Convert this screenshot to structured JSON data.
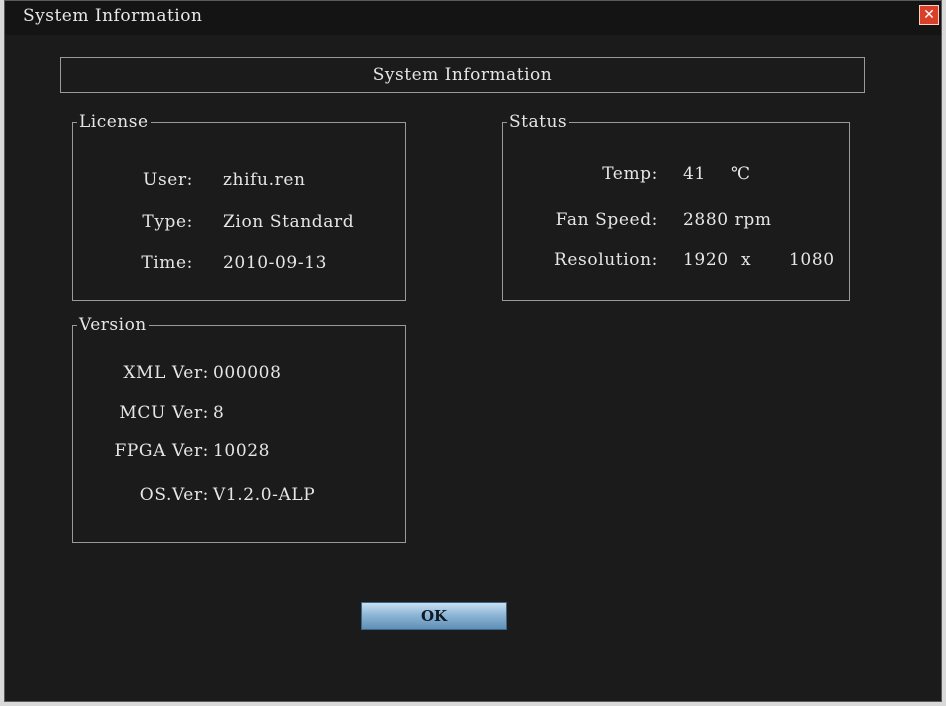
{
  "window": {
    "title": "System Information"
  },
  "header": {
    "title": "System Information"
  },
  "license": {
    "legend": "License",
    "user_label": "User:",
    "user_value": "zhifu.ren",
    "type_label": "Type:",
    "type_value": "Zion Standard",
    "time_label": "Time:",
    "time_value": "2010-09-13"
  },
  "status": {
    "legend": "Status",
    "temp_label": "Temp:",
    "temp_value": "41",
    "temp_unit": "℃",
    "fan_label": "Fan Speed:",
    "fan_value": "2880 rpm",
    "res_label": "Resolution:",
    "res_width": "1920",
    "res_sep": "x",
    "res_height": "1080"
  },
  "version": {
    "legend": "Version",
    "xml_label": "XML Ver:",
    "xml_value": "000008",
    "mcu_label": "MCU Ver:",
    "mcu_value": "8",
    "fpga_label": "FPGA Ver:",
    "fpga_value": "10028",
    "os_label": "OS.Ver:",
    "os_value": "V1.2.0-ALP"
  },
  "buttons": {
    "ok_label": "OK"
  },
  "icons": {
    "close": "close-icon"
  },
  "colors": {
    "background": "#1b1b1b",
    "border": "#9a9a9a",
    "ok_button": "#8fb6d6",
    "close_button": "#d8402a"
  }
}
